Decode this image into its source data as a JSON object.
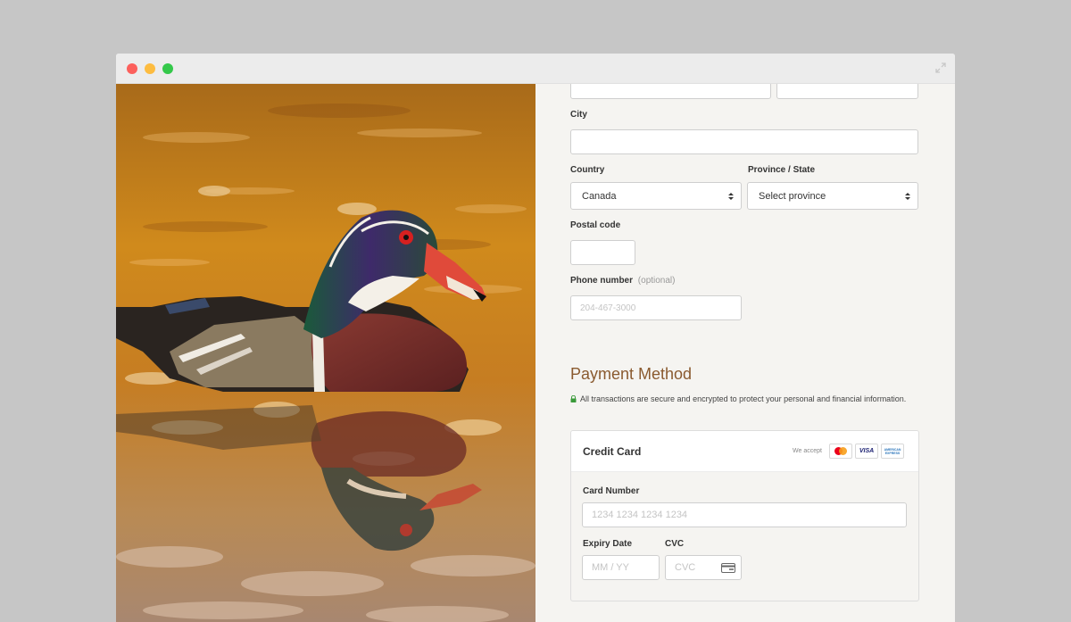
{
  "form": {
    "city_label": "City",
    "city_value": "",
    "country_label": "Country",
    "country_value": "Canada",
    "province_label": "Province / State",
    "province_value": "Select province",
    "postal_label": "Postal code",
    "postal_value": "",
    "phone_label": "Phone number",
    "phone_optional": "(optional)",
    "phone_placeholder": "204-467-3000"
  },
  "payment": {
    "title": "Payment Method",
    "secure_note": "All transactions are secure and encrypted to protect your personal and financial information.",
    "card_title": "Credit Card",
    "we_accept": "We accept",
    "brands": [
      "mastercard-icon",
      "visa-icon",
      "amex-icon"
    ],
    "visa_text": "VISA",
    "amex_text": "AMERICAN EXPRESS",
    "card_number_label": "Card Number",
    "card_number_placeholder": "1234 1234 1234 1234",
    "expiry_label": "Expiry Date",
    "expiry_placeholder": "MM / YY",
    "cvc_label": "CVC",
    "cvc_placeholder": "CVC"
  },
  "colors": {
    "accent": "#8a5a2f",
    "window_red": "#fc605c",
    "window_yellow": "#fdbc40",
    "window_green": "#34c84a"
  }
}
